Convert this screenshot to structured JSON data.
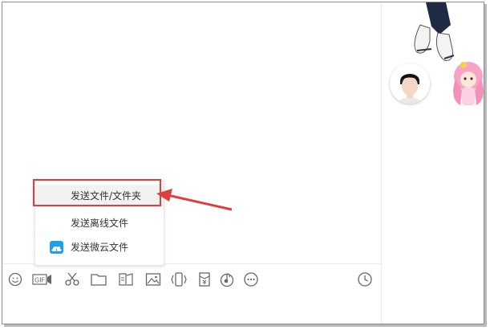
{
  "menu": {
    "items": [
      {
        "label": "发送文件/文件夹"
      },
      {
        "label": "发送离线文件"
      },
      {
        "label": "发送微云文件"
      }
    ]
  },
  "toolbar": {
    "gif_label": "GIF",
    "icons": [
      "emoji-icon",
      "gif-icon",
      "scissors-icon",
      "folder-icon",
      "image-text-icon",
      "image-icon",
      "shake-icon",
      "red-packet-icon",
      "music-icon",
      "more-icon",
      "history-clock-icon"
    ]
  },
  "colors": {
    "highlight_red": "#e03e3e",
    "cloud_blue": "#1fa0e6",
    "icon_gray": "#666666"
  }
}
